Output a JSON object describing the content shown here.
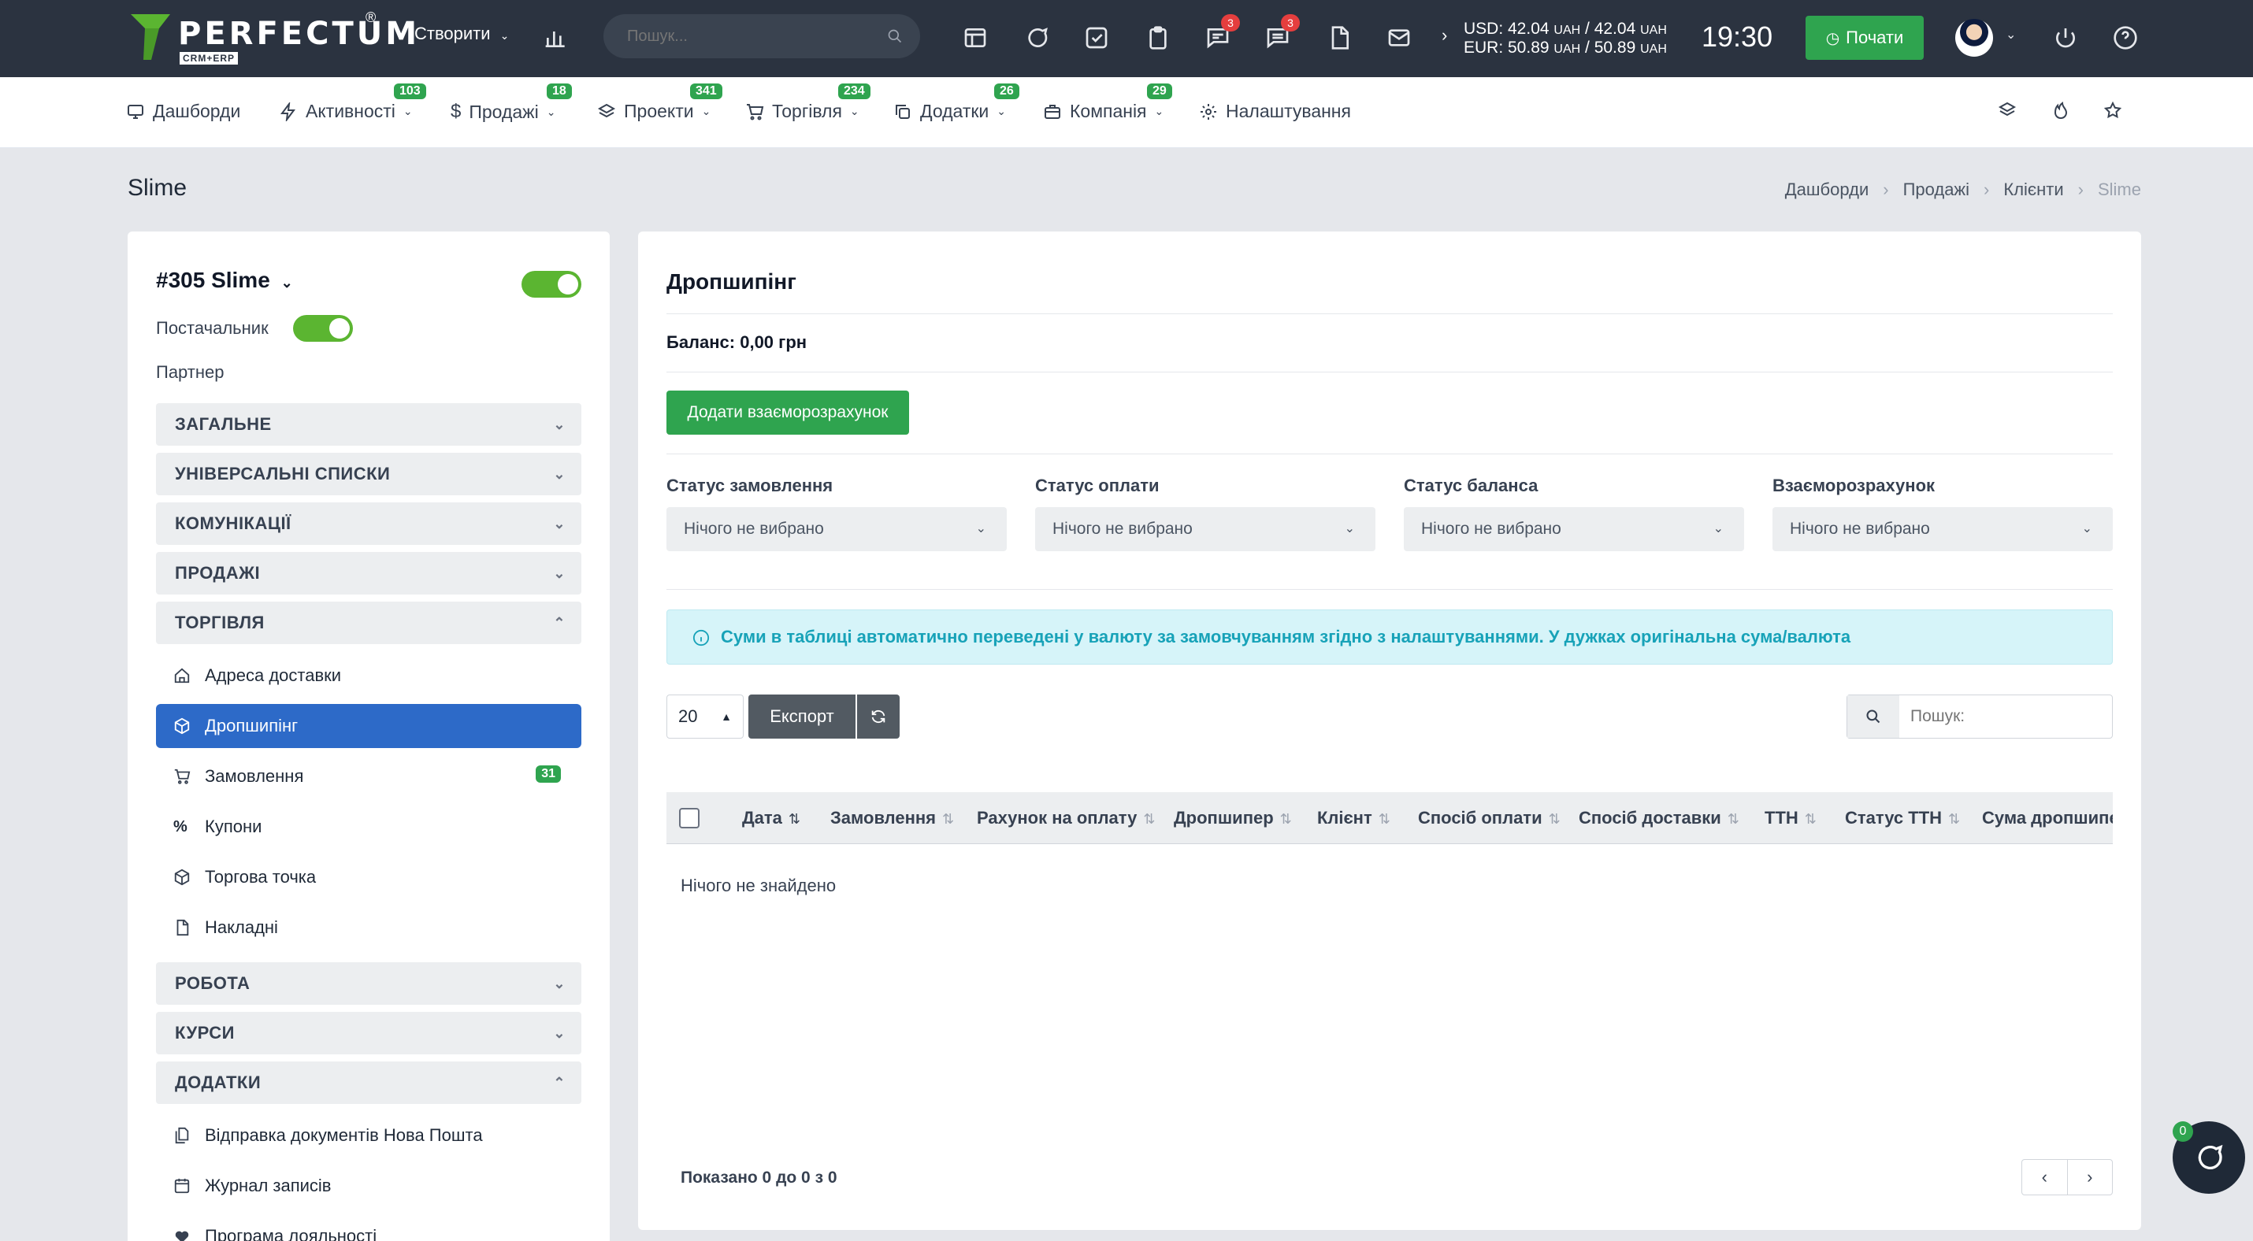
{
  "topbar": {
    "logo_text": "PERFECTUM",
    "logo_reg": "®",
    "logo_sub": "CRM+ERP",
    "create_label": "Створити",
    "search_placeholder": "Пошук...",
    "badges": {
      "messages": "3",
      "chat": "3"
    },
    "currency": {
      "usd": "USD: 42.04",
      "usd_unit": "UAH",
      "usd_sep": "/ 42.04",
      "usd_unit2": "UAH",
      "eur": "EUR: 50.89",
      "eur_unit": "UAH",
      "eur_sep": "/ 50.89",
      "eur_unit2": "UAH"
    },
    "clock": "19:30",
    "start_label": "Почати"
  },
  "nav": [
    {
      "label": "Дашборди",
      "badge": "",
      "icon": "monitor-icon"
    },
    {
      "label": "Активності",
      "badge": "103",
      "icon": "bolt-icon"
    },
    {
      "label": "Продажі",
      "badge": "18",
      "icon": "dollar-icon"
    },
    {
      "label": "Проекти",
      "badge": "341",
      "icon": "layers-icon"
    },
    {
      "label": "Торгівля",
      "badge": "234",
      "icon": "cart-icon"
    },
    {
      "label": "Додатки",
      "badge": "26",
      "icon": "copy-icon"
    },
    {
      "label": "Компанія",
      "badge": "29",
      "icon": "briefcase-icon"
    },
    {
      "label": "Налаштування",
      "badge": "",
      "icon": "gear-icon"
    }
  ],
  "page": {
    "title": "Slime",
    "breadcrumbs": [
      "Дашборди",
      "Продажі",
      "Клієнти",
      "Slime"
    ]
  },
  "client": {
    "title": "#305 Slime",
    "supplier_label": "Постачальник",
    "partner_label": "Партнер",
    "sections_top": [
      "ЗАГАЛЬНЕ",
      "УНІВЕРСАЛЬНІ СПИСКИ",
      "КОМУНІКАЦІЇ",
      "ПРОДАЖІ",
      "ТОРГІВЛЯ"
    ],
    "trade_items": [
      {
        "label": "Адреса доставки",
        "badge": ""
      },
      {
        "label": "Дропшипінг",
        "badge": ""
      },
      {
        "label": "Замовлення",
        "badge": "31"
      },
      {
        "label": "Купони",
        "badge": ""
      },
      {
        "label": "Торгова точка",
        "badge": ""
      },
      {
        "label": "Накладні",
        "badge": ""
      }
    ],
    "sections_mid": [
      "РОБОТА",
      "КУРСИ",
      "ДОДАТКИ"
    ],
    "addon_items": [
      "Відправка документів Нова Пошта",
      "Журнал записів",
      "Програма лояльності"
    ]
  },
  "main": {
    "title": "Дропшипінг",
    "balance": "Баланс: 0,00 грн",
    "add_button": "Додати взаєморозрахунок",
    "filters": [
      {
        "label": "Статус замовлення",
        "value": "Нічого не вибрано"
      },
      {
        "label": "Статус оплати",
        "value": "Нічого не вибрано"
      },
      {
        "label": "Статус баланса",
        "value": "Нічого не вибрано"
      },
      {
        "label": "Взаєморозрахунок",
        "value": "Нічого не вибрано"
      }
    ],
    "alert": "Суми в таблиці автоматично переведені у валюту за замовчуванням згідно з налаштуваннями. У дужках оригінальна сума/валюта",
    "per_page": "20",
    "export_label": "Експорт",
    "search_placeholder": "Пошук:",
    "columns": [
      "Дата",
      "Замовлення",
      "Рахунок на оплату",
      "Дропшипер",
      "Клієнт",
      "Спосіб оплати",
      "Спосіб доставки",
      "ТТН",
      "Статус ТТН",
      "Сума дропшипера"
    ],
    "empty_text": "Нічого не знайдено",
    "shown_text": "Показано 0 до 0 з 0",
    "pager_prev": "‹",
    "pager_next": "›"
  },
  "chat": {
    "badge": "0"
  }
}
